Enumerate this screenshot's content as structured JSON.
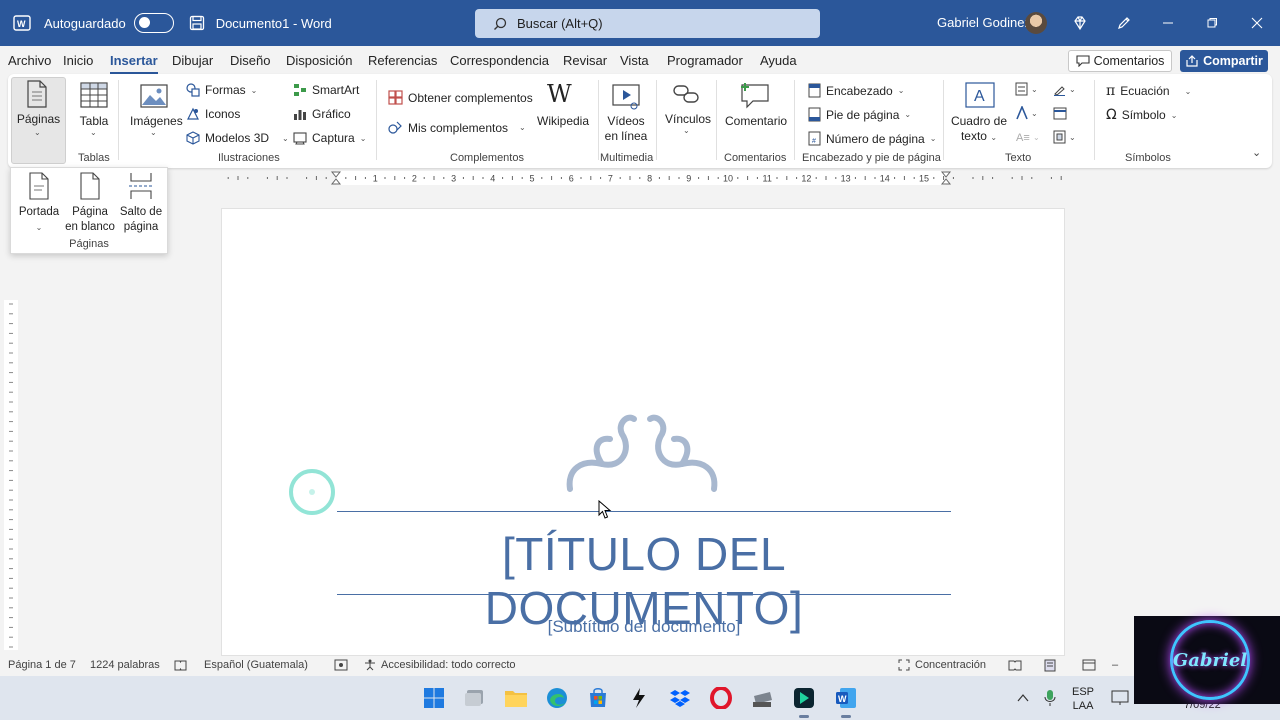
{
  "titlebar": {
    "autosave_label": "Autoguardado",
    "document_name": "Documento1 - Word",
    "search_placeholder": "Buscar (Alt+Q)",
    "user_name": "Gabriel Godinez"
  },
  "tabs": [
    "Archivo",
    "Inicio",
    "Insertar",
    "Dibujar",
    "Diseño",
    "Disposición",
    "Referencias",
    "Correspondencia",
    "Revisar",
    "Vista",
    "Programador",
    "Ayuda"
  ],
  "tabs_active": "Insertar",
  "header_buttons": {
    "comments": "Comentarios",
    "share": "Compartir"
  },
  "ribbon": {
    "paginas": "Páginas",
    "tabla": "Tabla",
    "imagenes": "Imágenes",
    "formas": "Formas",
    "iconos": "Iconos",
    "modelos3d": "Modelos 3D",
    "smartart": "SmartArt",
    "grafico": "Gráfico",
    "captura": "Captura",
    "obtener_complementos": "Obtener complementos",
    "mis_complementos": "Mis complementos",
    "wikipedia": "Wikipedia",
    "videos_1": "Vídeos",
    "videos_2": "en línea",
    "vinculos": "Vínculos",
    "comentario": "Comentario",
    "encabezado": "Encabezado",
    "pie_pagina": "Pie de página",
    "numero_pagina": "Número de página",
    "cuadro_texto_1": "Cuadro de",
    "cuadro_texto_2": "texto",
    "ecuacion": "Ecuación",
    "simbolo": "Símbolo",
    "groups": {
      "tablas": "Tablas",
      "ilustraciones": "Ilustraciones",
      "complementos": "Complementos",
      "multimedia": "Multimedia",
      "comentarios": "Comentarios",
      "encabezado_pie": "Encabezado y pie de página",
      "texto": "Texto",
      "simbolos": "Símbolos"
    }
  },
  "dropdown": {
    "portada": "Portada",
    "pagina_blanco_1": "Página",
    "pagina_blanco_2": "en blanco",
    "salto_1": "Salto de",
    "salto_2": "página",
    "group": "Páginas"
  },
  "ruler_numbers": [
    "1",
    "2",
    "3",
    "4",
    "5",
    "6",
    "7",
    "8",
    "9",
    "10",
    "11",
    "12",
    "13",
    "14",
    "15"
  ],
  "document": {
    "title": "[TÍTULO DEL DOCUMENTO]",
    "subtitle": "[Subtítulo del documento]"
  },
  "statusbar": {
    "page": "Página 1 de 7",
    "words": "1224 palabras",
    "language": "Español (Guatemala)",
    "accessibility": "Accesibilidad: todo correcto",
    "focus": "Concentración"
  },
  "taskbar": {
    "lang_1": "ESP",
    "lang_2": "LAA",
    "clock": "7/09/22"
  },
  "overlay": {
    "name": "Gabriel"
  },
  "colors": {
    "brand": "#2b579a",
    "doc_accent": "#4a6fa5"
  }
}
